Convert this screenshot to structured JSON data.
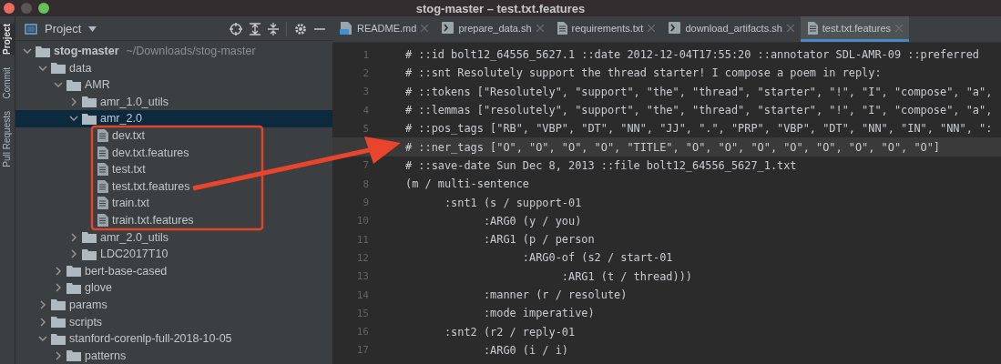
{
  "window": {
    "title": "stog-master – test.txt.features"
  },
  "tool_strip": [
    {
      "label": "Project",
      "selected": true
    },
    {
      "label": "Commit",
      "selected": false
    },
    {
      "label": "Pull Requests",
      "selected": false
    }
  ],
  "project_panel": {
    "title": "Project",
    "tree": [
      {
        "name": "stog-master",
        "path": "~/Downloads/stog-master",
        "kind": "folder",
        "expanded": true,
        "selected": false,
        "children": [
          {
            "name": "data",
            "kind": "folder",
            "expanded": true,
            "selected": false,
            "children": [
              {
                "name": "AMR",
                "kind": "folder",
                "expanded": true,
                "selected": false,
                "children": [
                  {
                    "name": "amr_1.0_utils",
                    "kind": "folder",
                    "expanded": false,
                    "selected": false
                  },
                  {
                    "name": "amr_2.0",
                    "kind": "folder",
                    "expanded": true,
                    "selected": true,
                    "children": [
                      {
                        "name": "dev.txt",
                        "kind": "file",
                        "selected": false
                      },
                      {
                        "name": "dev.txt.features",
                        "kind": "file",
                        "selected": false
                      },
                      {
                        "name": "test.txt",
                        "kind": "file",
                        "selected": false
                      },
                      {
                        "name": "test.txt.features",
                        "kind": "file",
                        "selected": false
                      },
                      {
                        "name": "train.txt",
                        "kind": "file",
                        "selected": false
                      },
                      {
                        "name": "train.txt.features",
                        "kind": "file",
                        "selected": false
                      }
                    ]
                  },
                  {
                    "name": "amr_2.0_utils",
                    "kind": "folder",
                    "expanded": false,
                    "selected": false
                  },
                  {
                    "name": "LDC2017T10",
                    "kind": "folder",
                    "expanded": false,
                    "selected": false
                  }
                ]
              },
              {
                "name": "bert-base-cased",
                "kind": "folder",
                "expanded": false,
                "selected": false
              },
              {
                "name": "glove",
                "kind": "folder",
                "expanded": false,
                "selected": false
              }
            ]
          },
          {
            "name": "params",
            "kind": "folder",
            "expanded": false,
            "selected": false
          },
          {
            "name": "scripts",
            "kind": "folder",
            "expanded": false,
            "selected": false
          },
          {
            "name": "stanford-corenlp-full-2018-10-05",
            "kind": "folder",
            "expanded": true,
            "selected": false,
            "children": [
              {
                "name": "patterns",
                "kind": "folder",
                "expanded": false,
                "selected": false
              }
            ]
          }
        ]
      }
    ]
  },
  "editor_tabs": [
    {
      "label": "README.md",
      "kind": "markdown",
      "selected": false
    },
    {
      "label": "prepare_data.sh",
      "kind": "shell",
      "selected": false
    },
    {
      "label": "requirements.txt",
      "kind": "text",
      "selected": false
    },
    {
      "label": "download_artifacts.sh",
      "kind": "shell",
      "selected": false
    },
    {
      "label": "test.txt.features",
      "kind": "text",
      "selected": true
    }
  ],
  "editor_lines": [
    {
      "number": "1",
      "text": "# ::id bolt12_64556_5627.1 ::date 2012-12-04T17:55:20 ::annotator SDL-AMR-09 ::preferred",
      "current": false
    },
    {
      "number": "2",
      "text": "# ::snt Resolutely support the thread starter! I compose a poem in reply:",
      "current": false
    },
    {
      "number": "3",
      "text": "# ::tokens [\"Resolutely\", \"support\", \"the\", \"thread\", \"starter\", \"!\", \"I\", \"compose\", \"a\",",
      "current": false
    },
    {
      "number": "4",
      "text": "# ::lemmas [\"resolutely\", \"support\", \"the\", \"thread\", \"starter\", \"!\", \"I\", \"compose\", \"a\",",
      "current": false
    },
    {
      "number": "5",
      "text": "# ::pos_tags [\"RB\", \"VBP\", \"DT\", \"NN\", \"JJ\", \".\", \"PRP\", \"VBP\", \"DT\", \"NN\", \"IN\", \"NN\", \":",
      "current": false
    },
    {
      "text": "# ::ner_tags [\"O\", \"O\", \"O\", \"O\", \"TITLE\", \"O\", \"O\", \"O\", \"O\", \"O\", \"O\", \"O\", \"O\"]",
      "current": true
    },
    {
      "number": "7",
      "text": "# ::save-date Sun Dec 8, 2013 ::file bolt12_64556_5627_1.txt",
      "current": false
    },
    {
      "number": "8",
      "text": "(m / multi-sentence",
      "current": false
    },
    {
      "number": "9",
      "text": "      :snt1 (s / support-01",
      "current": false
    },
    {
      "number": "10",
      "text": "            :ARG0 (y / you)",
      "current": false
    },
    {
      "number": "11",
      "text": "            :ARG1 (p / person",
      "current": false
    },
    {
      "number": "12",
      "text": "                  :ARG0-of (s2 / start-01",
      "current": false
    },
    {
      "number": "13",
      "text": "                        :ARG1 (t / thread)))",
      "current": false
    },
    {
      "number": "14",
      "text": "            :manner (r / resolute)",
      "current": false
    },
    {
      "number": "15",
      "text": "            :mode imperative)",
      "current": false
    },
    {
      "number": "16",
      "text": "      :snt2 (r2 / reply-01",
      "current": false
    },
    {
      "number": "17",
      "text": "            :ARG0 (i / i)",
      "current": false
    }
  ]
}
